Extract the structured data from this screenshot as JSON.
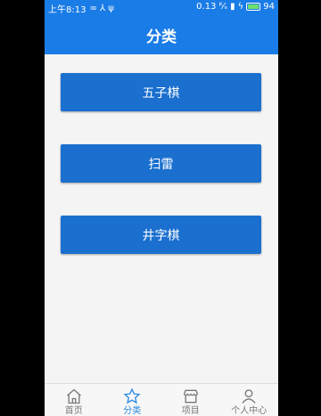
{
  "status_bar": {
    "time": "上午8:13",
    "extra_icons": "∞ ⅄ ψ",
    "net_speed": "0.13 ᴷ⁄ₛ",
    "battery": "94"
  },
  "app_bar": {
    "title": "分类"
  },
  "categories": [
    {
      "label": "五子棋"
    },
    {
      "label": "扫雷"
    },
    {
      "label": "井字棋"
    }
  ],
  "tab_bar": {
    "active_index": 1,
    "active_color": "#2a8ae0",
    "items": [
      {
        "label": "首页",
        "icon": "home-icon"
      },
      {
        "label": "分类",
        "icon": "star-icon"
      },
      {
        "label": "项目",
        "icon": "store-icon"
      },
      {
        "label": "个人中心",
        "icon": "person-icon"
      }
    ]
  }
}
